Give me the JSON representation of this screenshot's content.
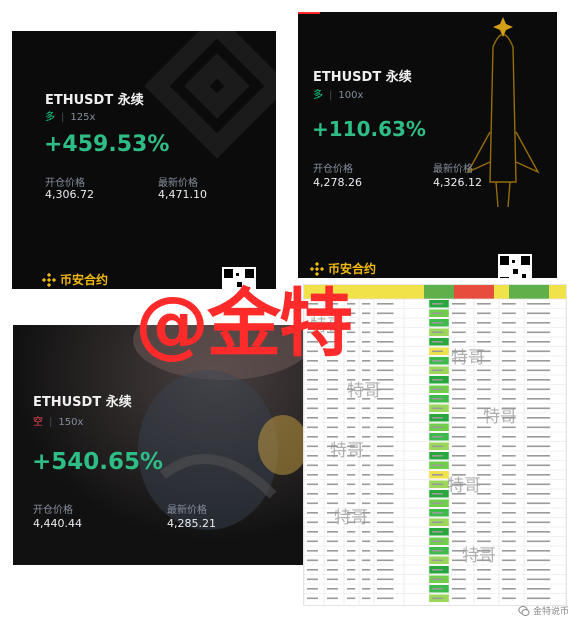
{
  "cards": [
    {
      "title": "ETHUSDT 永续",
      "side": "多",
      "leverage": "125x",
      "pnl": "+459.53%",
      "entry_label": "开仓价格",
      "entry_price": "4,306.72",
      "last_label": "最新价格",
      "last_price": "4,471.10",
      "brand": "币安合约"
    },
    {
      "title": "ETHUSDT 永续",
      "side": "多",
      "leverage": "100x",
      "pnl": "+110.63%",
      "entry_label": "开仓价格",
      "entry_price": "4,278.26",
      "last_label": "最新价格",
      "last_price": "4,326.12",
      "brand": "币安合约"
    },
    {
      "title": "ETHUSDT 永续",
      "side": "空",
      "leverage": "150x",
      "pnl": "+540.65%",
      "entry_label": "开仓价格",
      "entry_price": "4,440.44",
      "last_label": "最新价格",
      "last_price": "4,285.21"
    }
  ],
  "overlay": {
    "handle": "@金特",
    "sheet_watermark": "特哥",
    "footer": "金特说币"
  },
  "colors": {
    "long": "#0ecb81",
    "short": "#f6465d",
    "pnl": "#2ebd85",
    "brand": "#f0b90b",
    "watermark": "#ff2a2a"
  }
}
